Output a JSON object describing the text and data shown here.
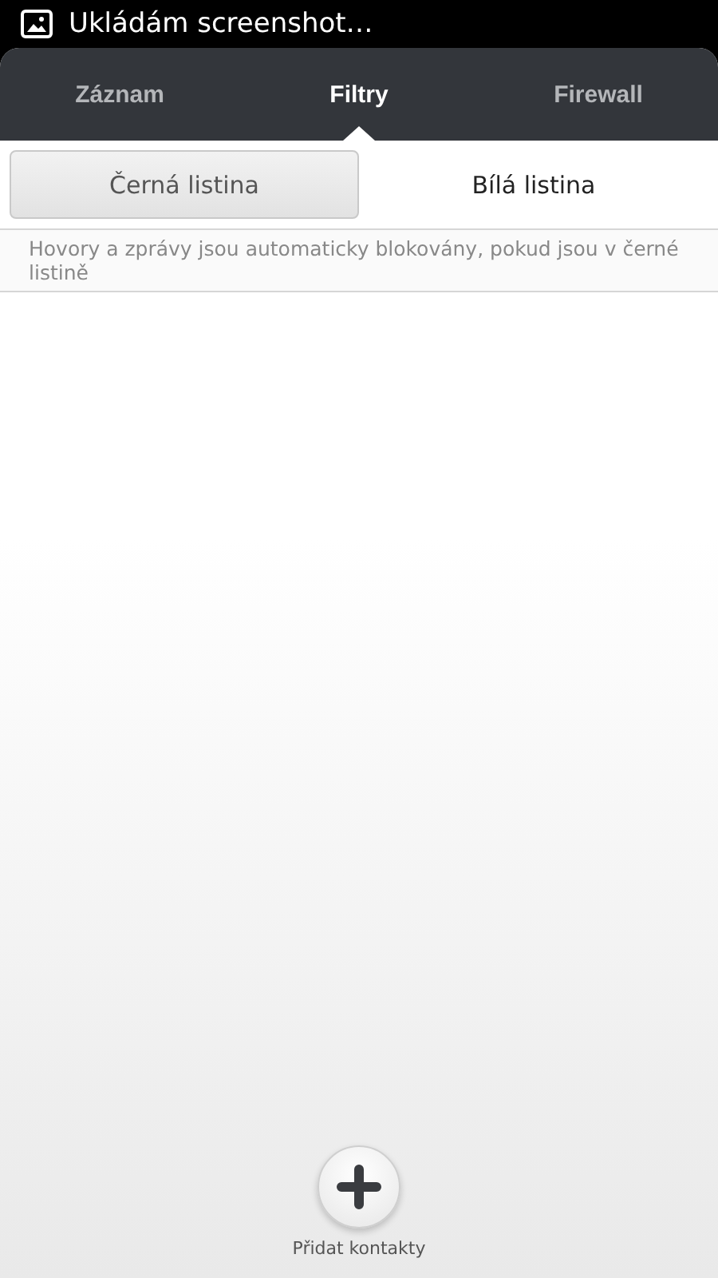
{
  "status_bar": {
    "notification": "Ukládám screenshot…"
  },
  "tabs": [
    {
      "label": "Záznam",
      "selected": false
    },
    {
      "label": "Filtry",
      "selected": true
    },
    {
      "label": "Firewall",
      "selected": false
    }
  ],
  "segments": [
    {
      "label": "Černá listina",
      "selected": true
    },
    {
      "label": "Bílá listina",
      "selected": false
    }
  ],
  "description": "Hovory a zprávy jsou automaticky blokovány, pokud jsou v černé listině",
  "add_button": {
    "label": "Přidat kontakty"
  }
}
